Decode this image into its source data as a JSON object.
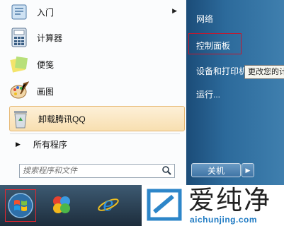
{
  "start_menu": {
    "programs": [
      {
        "label": "入门",
        "icon": "getting-started-icon",
        "has_submenu": true
      },
      {
        "label": "计算器",
        "icon": "calculator-icon"
      },
      {
        "label": "便笺",
        "icon": "sticky-notes-icon"
      },
      {
        "label": "画图",
        "icon": "paint-icon"
      },
      {
        "label": "卸载腾讯QQ",
        "icon": "recycle-bin-icon",
        "highlighted": true
      }
    ],
    "all_programs": "所有程序",
    "search_placeholder": "搜索程序和文件",
    "right_items": [
      "网络",
      "控制面板",
      "设备和打印机",
      "运行..."
    ],
    "tooltip": "更改您的计",
    "shutdown_label": "关机"
  },
  "watermark": {
    "brand": "爱纯净",
    "url": "aichunjing.com"
  },
  "colors": {
    "highlight_border": "#c4182e",
    "right_pane": "#2c6a9b",
    "watermark_url": "#1e7ac3"
  }
}
